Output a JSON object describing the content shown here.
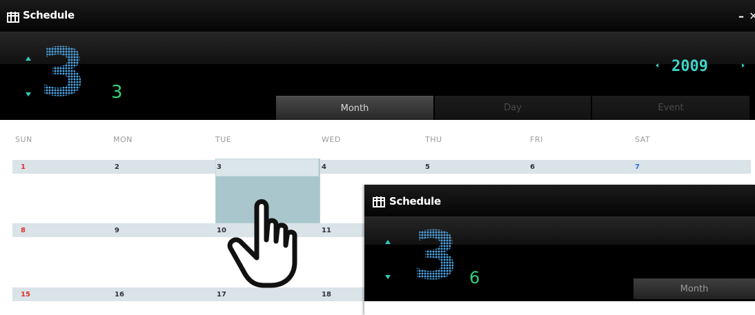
{
  "window": {
    "title": "Schedule",
    "minimize_glyph": "–",
    "close_glyph": "×",
    "icon": "calendar-icon"
  },
  "header": {
    "month_big": "3",
    "month_small": "3",
    "year": "2009",
    "tabs": [
      {
        "label": "Month",
        "active": true
      },
      {
        "label": "Day",
        "active": false
      },
      {
        "label": "Event",
        "active": false
      }
    ]
  },
  "calendar": {
    "weekdays": [
      "SUN",
      "MON",
      "TUE",
      "WED",
      "THU",
      "FRI",
      "SAT"
    ],
    "weeks": [
      [
        "1",
        "2",
        "3",
        "4",
        "5",
        "6",
        "7"
      ],
      [
        "8",
        "9",
        "10",
        "11"
      ],
      [
        "15",
        "16",
        "17",
        "18"
      ]
    ],
    "selected_day": "3"
  },
  "overlay_window": {
    "title": "Schedule",
    "month_big": "3",
    "month_small": "6",
    "tab_label": "Month"
  },
  "colors": {
    "titlebar": "#0b0b0b",
    "accent_teal": "#35c8c0",
    "big_digit_blue": "#4fa8e8",
    "small_digit_green": "#2fd07a",
    "sunday_red": "#e03030",
    "saturday_blue": "#2a6fd6",
    "week_band": "#d9e3e8",
    "selected_cell": "#a8c6cc"
  },
  "cursor": {
    "icon": "hand-pointer-icon"
  }
}
